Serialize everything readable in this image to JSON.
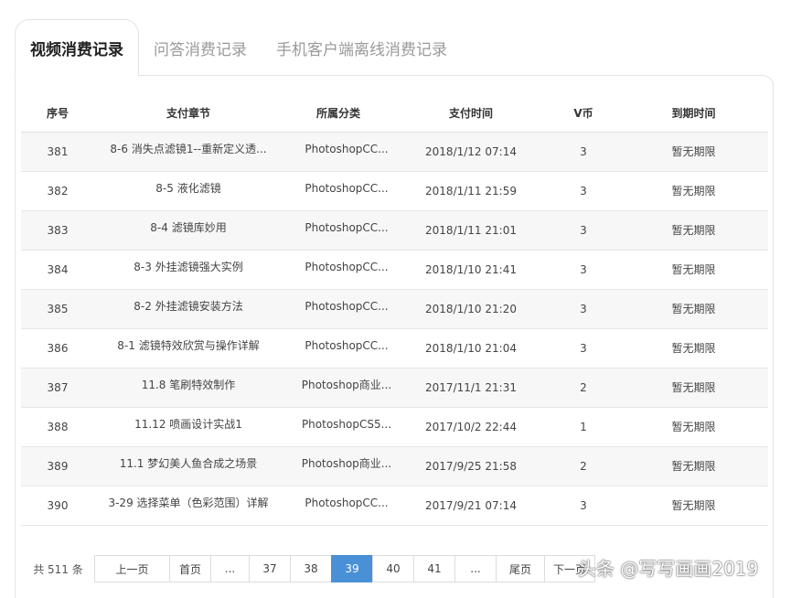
{
  "tabs": [
    {
      "label": "视频消费记录",
      "active": true
    },
    {
      "label": "问答消费记录",
      "active": false
    },
    {
      "label": "手机客户端离线消费记录",
      "active": false
    }
  ],
  "table": {
    "headers": [
      "序号",
      "支付章节",
      "所属分类",
      "支付时间",
      "V币",
      "到期时间"
    ],
    "rows": [
      {
        "id": "381",
        "chapter": "8-6 消失点滤镜1--重新定义透...",
        "category": "PhotoshopCC...",
        "time": "2018/1/12 07:14",
        "coins": "3",
        "expiry": "暂无期限"
      },
      {
        "id": "382",
        "chapter": "8-5 液化滤镜",
        "category": "PhotoshopCC...",
        "time": "2018/1/11 21:59",
        "coins": "3",
        "expiry": "暂无期限"
      },
      {
        "id": "383",
        "chapter": "8-4 滤镜库妙用",
        "category": "PhotoshopCC...",
        "time": "2018/1/11 21:01",
        "coins": "3",
        "expiry": "暂无期限"
      },
      {
        "id": "384",
        "chapter": "8-3 外挂滤镜强大实例",
        "category": "PhotoshopCC...",
        "time": "2018/1/10 21:41",
        "coins": "3",
        "expiry": "暂无期限"
      },
      {
        "id": "385",
        "chapter": "8-2 外挂滤镜安装方法",
        "category": "PhotoshopCC...",
        "time": "2018/1/10 21:20",
        "coins": "3",
        "expiry": "暂无期限"
      },
      {
        "id": "386",
        "chapter": "8-1 滤镜特效欣赏与操作详解",
        "category": "PhotoshopCC...",
        "time": "2018/1/10 21:04",
        "coins": "3",
        "expiry": "暂无期限"
      },
      {
        "id": "387",
        "chapter": "11.8 笔刷特效制作",
        "category": "Photoshop商业...",
        "time": "2017/11/1 21:31",
        "coins": "2",
        "expiry": "暂无期限"
      },
      {
        "id": "388",
        "chapter": "11.12 喷画设计实战1",
        "category": "PhotoshopCS5...",
        "time": "2017/10/2 22:44",
        "coins": "1",
        "expiry": "暂无期限"
      },
      {
        "id": "389",
        "chapter": "11.1 梦幻美人鱼合成之场景",
        "category": "Photoshop商业...",
        "time": "2017/9/25 21:58",
        "coins": "2",
        "expiry": "暂无期限"
      },
      {
        "id": "390",
        "chapter": "3-29 选择菜单（色彩范围）详解",
        "category": "PhotoshopCC...",
        "time": "2017/9/21 07:14",
        "coins": "3",
        "expiry": "暂无期限"
      }
    ]
  },
  "pager": {
    "total": "共 511 条",
    "buttons": [
      {
        "label": "上一页",
        "name": "prev-page-button",
        "active": false
      },
      {
        "label": "首页",
        "name": "first-page-button",
        "active": false
      },
      {
        "label": "...",
        "name": "ellipsis-left",
        "active": false
      },
      {
        "label": "37",
        "name": "page-37-button",
        "active": false
      },
      {
        "label": "38",
        "name": "page-38-button",
        "active": false
      },
      {
        "label": "39",
        "name": "page-39-button",
        "active": true
      },
      {
        "label": "40",
        "name": "page-40-button",
        "active": false
      },
      {
        "label": "41",
        "name": "page-41-button",
        "active": false
      },
      {
        "label": "...",
        "name": "ellipsis-right",
        "active": false
      },
      {
        "label": "尾页",
        "name": "last-page-button",
        "active": false
      },
      {
        "label": "下一页",
        "name": "next-page-button",
        "active": false
      }
    ]
  },
  "watermark": "头条 @写写画画2019",
  "colors": {
    "accent": "#4a90d6",
    "row_alt": "#f7f7f7",
    "border": "#e3e3e3"
  }
}
